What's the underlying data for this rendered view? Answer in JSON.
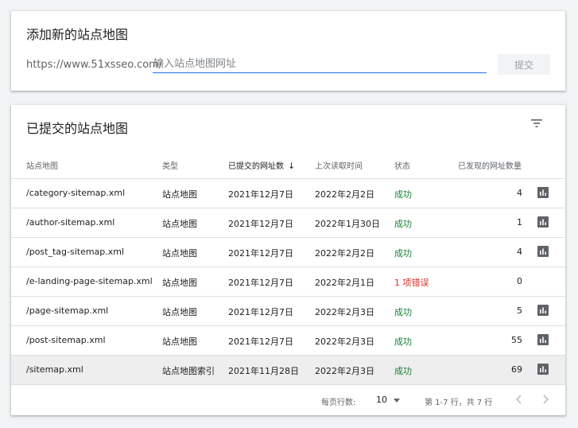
{
  "add_card": {
    "title": "添加新的站点地图",
    "url_prefix": "https://www.51xsseo.com/",
    "input_placeholder": "输入站点地图网址",
    "submit_label": "提交"
  },
  "list_card": {
    "title": "已提交的站点地图",
    "filter_icon": "filter-icon",
    "columns": {
      "sitemap": "站点地图",
      "type": "类型",
      "submitted": "已提交的网址数",
      "sort_indicator": "↓",
      "last_read": "上次读取时间",
      "status": "状态",
      "discovered": "已发现的网址数量"
    },
    "rows": [
      {
        "sitemap": "/category-sitemap.xml",
        "type": "站点地图",
        "submitted": "2021年12月7日",
        "last_read": "2022年2月2日",
        "status": "成功",
        "discovered": "4",
        "has_chart": true
      },
      {
        "sitemap": "/author-sitemap.xml",
        "type": "站点地图",
        "submitted": "2021年12月7日",
        "last_read": "2022年1月30日",
        "status": "成功",
        "discovered": "1",
        "has_chart": true
      },
      {
        "sitemap": "/post_tag-sitemap.xml",
        "type": "站点地图",
        "submitted": "2021年12月7日",
        "last_read": "2022年2月2日",
        "status": "成功",
        "discovered": "4",
        "has_chart": true
      },
      {
        "sitemap": "/e-landing-page-sitemap.xml",
        "type": "站点地图",
        "submitted": "2021年12月7日",
        "last_read": "2022年2月1日",
        "status": "1 项错误",
        "discovered": "0",
        "has_chart": false
      },
      {
        "sitemap": "/page-sitemap.xml",
        "type": "站点地图",
        "submitted": "2021年12月7日",
        "last_read": "2022年2月3日",
        "status": "成功",
        "discovered": "5",
        "has_chart": true
      },
      {
        "sitemap": "/post-sitemap.xml",
        "type": "站点地图",
        "submitted": "2021年12月7日",
        "last_read": "2022年2月3日",
        "status": "成功",
        "discovered": "55",
        "has_chart": true
      },
      {
        "sitemap": "/sitemap.xml",
        "type": "站点地图索引",
        "submitted": "2021年11月28日",
        "last_read": "2022年2月3日",
        "status": "成功",
        "discovered": "69",
        "has_chart": true
      }
    ],
    "footer": {
      "rows_per_page_label": "每页行数:",
      "rows_per_page_value": "10",
      "range_text": "第 1-7 行，共 7 行"
    }
  },
  "colors": {
    "accent": "#1a73e8",
    "success": "#188038",
    "error": "#d93025",
    "icon": "#5f6368"
  }
}
